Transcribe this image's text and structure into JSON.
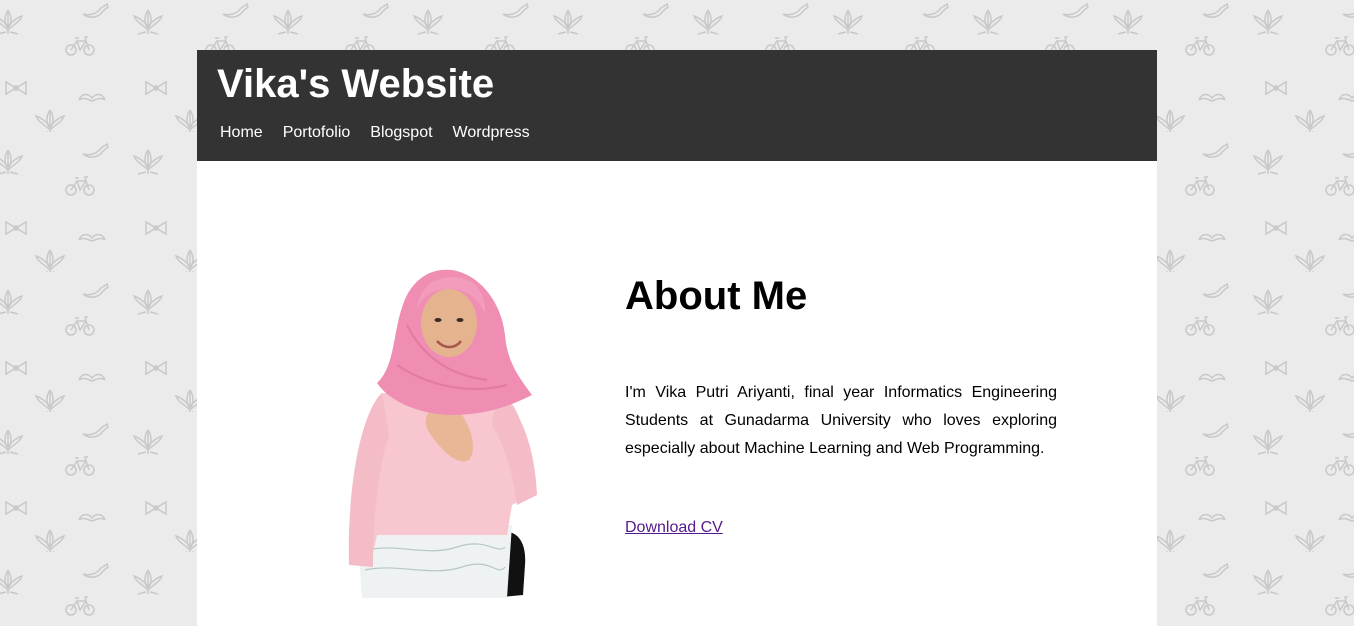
{
  "page": {
    "background_color": "#ebebeb",
    "pattern_color": "#c9c9c9"
  },
  "header": {
    "site_title": "Vika's Website",
    "background_color": "#333333",
    "nav": [
      {
        "label": "Home"
      },
      {
        "label": "Portofolio"
      },
      {
        "label": "Blogspot"
      },
      {
        "label": "Wordpress"
      }
    ]
  },
  "about": {
    "heading": "About Me",
    "text": "I'm Vika Putri Ariyanti, final year Informatics Engineering Students at Gunadarma University who loves exploring especially about Machine Learning and Web Programming.",
    "cv_link": "Download CV",
    "link_color": "#551a8b"
  },
  "photo": {
    "icon": "profile-photo"
  }
}
